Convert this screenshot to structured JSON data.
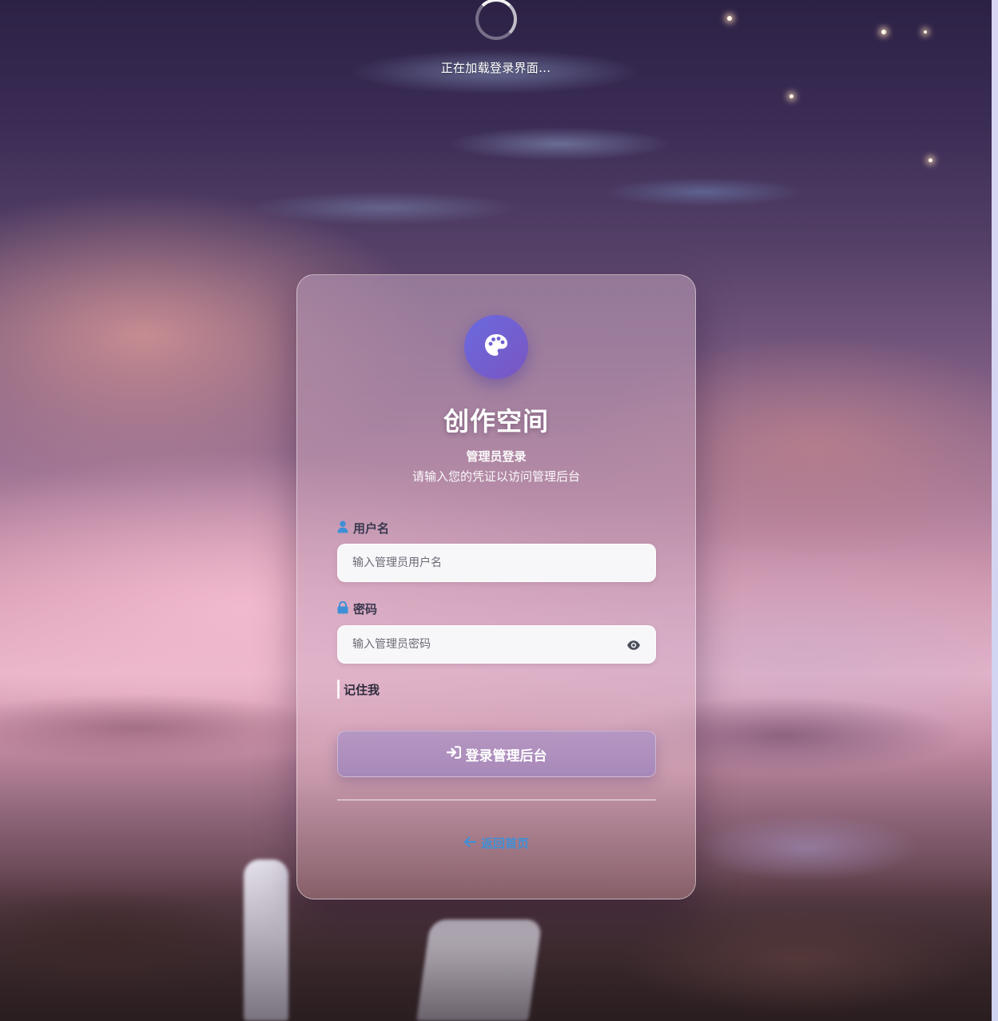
{
  "loading": {
    "text": "正在加载登录界面..."
  },
  "card": {
    "logo_icon": "palette-icon",
    "title": "创作空间",
    "subtitle": "管理员登录",
    "description": "请输入您的凭证以访问管理后台"
  },
  "form": {
    "username": {
      "icon": "user-icon",
      "label": "用户名",
      "placeholder": "输入管理员用户名",
      "value": ""
    },
    "password": {
      "icon": "lock-icon",
      "label": "密码",
      "placeholder": "输入管理员密码",
      "value": "",
      "toggle_icon": "eye-icon"
    },
    "remember_label": "记住我",
    "submit": {
      "icon": "sign-in-icon",
      "label": "登录管理后台"
    },
    "back": {
      "icon": "arrow-left-icon",
      "label": "返回首页"
    }
  },
  "colors": {
    "logo_gradient_start": "#6a6ae0",
    "logo_gradient_end": "#7a55c0",
    "label_icon": "#3f8fd6",
    "link": "#3f8fd6",
    "title": "#ffffff"
  }
}
